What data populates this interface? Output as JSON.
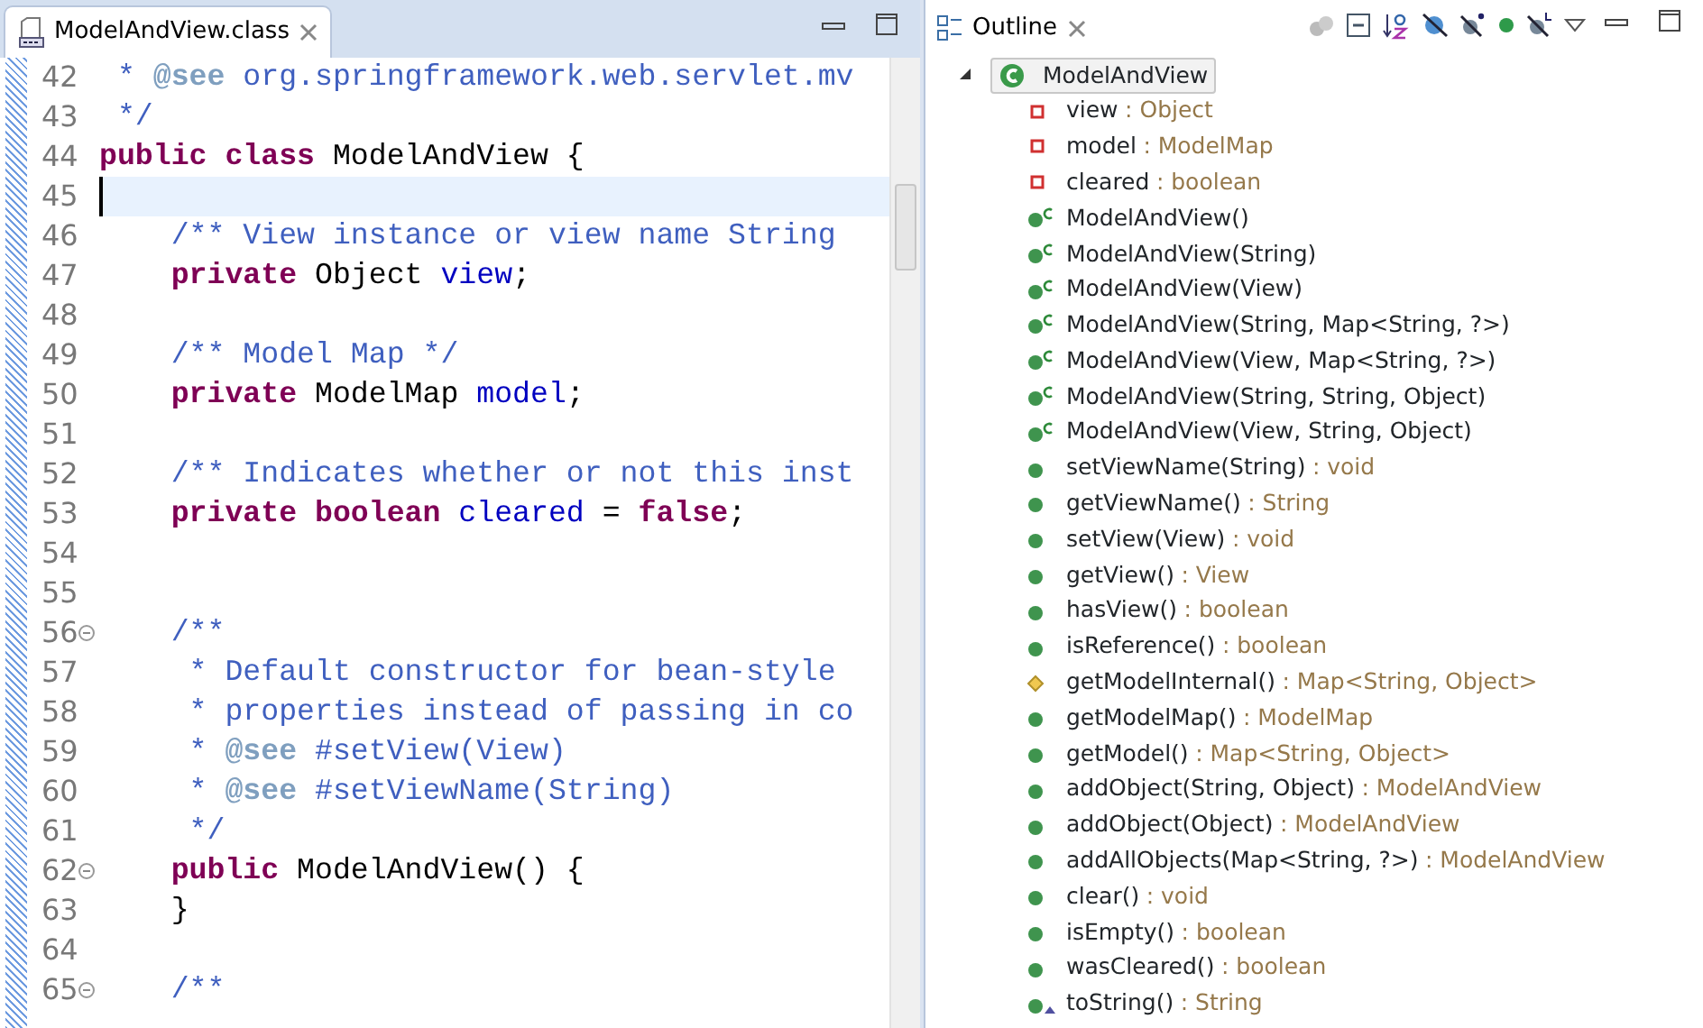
{
  "editor": {
    "tab": {
      "title": "ModelAndView.class",
      "selected": true
    },
    "lines": [
      {
        "number": "42",
        "fold": false,
        "current": false,
        "tokens": [
          {
            "kind": "comment",
            "text": " * "
          },
          {
            "kind": "doctag",
            "text": "@see"
          },
          {
            "kind": "comment",
            "text": " org.springframework.web.servlet.mv"
          }
        ]
      },
      {
        "number": "43",
        "fold": false,
        "current": false,
        "tokens": [
          {
            "kind": "comment",
            "text": " */"
          }
        ]
      },
      {
        "number": "44",
        "fold": false,
        "current": false,
        "tokens": [
          {
            "kind": "keyword",
            "text": "public class"
          },
          {
            "kind": "plain",
            "text": " ModelAndView {"
          }
        ]
      },
      {
        "number": "45",
        "fold": false,
        "current": true
      },
      {
        "number": "46",
        "fold": false,
        "current": false,
        "tokens": [
          {
            "kind": "comment",
            "text": "    /** View instance or view name String"
          }
        ]
      },
      {
        "number": "47",
        "fold": false,
        "current": false,
        "tokens": [
          {
            "kind": "keyword",
            "text": "    private"
          },
          {
            "kind": "plain",
            "text": " Object "
          },
          {
            "kind": "field",
            "text": "view"
          },
          {
            "kind": "plain",
            "text": ";"
          }
        ]
      },
      {
        "number": "48",
        "fold": false,
        "current": false
      },
      {
        "number": "49",
        "fold": false,
        "current": false,
        "tokens": [
          {
            "kind": "comment",
            "text": "    /** Model Map */"
          }
        ]
      },
      {
        "number": "50",
        "fold": false,
        "current": false,
        "tokens": [
          {
            "kind": "keyword",
            "text": "    private"
          },
          {
            "kind": "plain",
            "text": " ModelMap "
          },
          {
            "kind": "field",
            "text": "model"
          },
          {
            "kind": "plain",
            "text": ";"
          }
        ]
      },
      {
        "number": "51",
        "fold": false,
        "current": false
      },
      {
        "number": "52",
        "fold": false,
        "current": false,
        "tokens": [
          {
            "kind": "comment",
            "text": "    /** Indicates whether or not this inst"
          }
        ]
      },
      {
        "number": "53",
        "fold": false,
        "current": false,
        "tokens": [
          {
            "kind": "keyword",
            "text": "    private boolean "
          },
          {
            "kind": "field",
            "text": "cleared"
          },
          {
            "kind": "plain",
            "text": " = "
          },
          {
            "kind": "keyword",
            "text": "false"
          },
          {
            "kind": "plain",
            "text": ";"
          }
        ]
      },
      {
        "number": "54",
        "fold": false,
        "current": false
      },
      {
        "number": "55",
        "fold": false,
        "current": false
      },
      {
        "number": "56",
        "fold": true,
        "current": false,
        "tokens": [
          {
            "kind": "comment",
            "text": "    /**"
          }
        ]
      },
      {
        "number": "57",
        "fold": false,
        "current": false,
        "tokens": [
          {
            "kind": "comment",
            "text": "     * Default constructor for bean-style"
          }
        ]
      },
      {
        "number": "58",
        "fold": false,
        "current": false,
        "tokens": [
          {
            "kind": "comment",
            "text": "     * properties instead of passing in co"
          }
        ]
      },
      {
        "number": "59",
        "fold": false,
        "current": false,
        "tokens": [
          {
            "kind": "comment",
            "text": "     * "
          },
          {
            "kind": "doctag",
            "text": "@see"
          },
          {
            "kind": "comment",
            "text": " #setView(View)"
          }
        ]
      },
      {
        "number": "60",
        "fold": false,
        "current": false,
        "tokens": [
          {
            "kind": "comment",
            "text": "     * "
          },
          {
            "kind": "doctag",
            "text": "@see"
          },
          {
            "kind": "comment",
            "text": " #setViewName(String)"
          }
        ]
      },
      {
        "number": "61",
        "fold": false,
        "current": false,
        "tokens": [
          {
            "kind": "comment",
            "text": "     */"
          }
        ]
      },
      {
        "number": "62",
        "fold": true,
        "current": false,
        "tokens": [
          {
            "kind": "keyword",
            "text": "    public"
          },
          {
            "kind": "plain",
            "text": " ModelAndView() {"
          }
        ]
      },
      {
        "number": "63",
        "fold": false,
        "current": false,
        "tokens": [
          {
            "kind": "plain",
            "text": "    }"
          }
        ]
      },
      {
        "number": "64",
        "fold": false,
        "current": false
      },
      {
        "number": "65",
        "fold": true,
        "current": false,
        "tokens": [
          {
            "kind": "comment",
            "text": "    /**"
          }
        ]
      }
    ]
  },
  "outline": {
    "tab": {
      "title": "Outline",
      "selected": true
    },
    "root": {
      "name": "ModelAndView",
      "expanded": true,
      "selected": true,
      "children": [
        {
          "kind": "field",
          "name": "view",
          "type": ": Object"
        },
        {
          "kind": "field",
          "name": "model",
          "type": ": ModelMap"
        },
        {
          "kind": "field",
          "name": "cleared",
          "type": ": boolean"
        },
        {
          "kind": "constructor",
          "name": "ModelAndView()"
        },
        {
          "kind": "constructor",
          "name": "ModelAndView(String)"
        },
        {
          "kind": "constructor",
          "name": "ModelAndView(View)"
        },
        {
          "kind": "constructor",
          "name": "ModelAndView(String, Map<String, ?>)"
        },
        {
          "kind": "constructor",
          "name": "ModelAndView(View, Map<String, ?>)"
        },
        {
          "kind": "constructor",
          "name": "ModelAndView(String, String, Object)"
        },
        {
          "kind": "constructor",
          "name": "ModelAndView(View, String, Object)"
        },
        {
          "kind": "method",
          "name": "setViewName(String)",
          "type": ": void"
        },
        {
          "kind": "method",
          "name": "getViewName()",
          "type": ": String"
        },
        {
          "kind": "method",
          "name": "setView(View)",
          "type": ": void"
        },
        {
          "kind": "method",
          "name": "getView()",
          "type": ": View"
        },
        {
          "kind": "method",
          "name": "hasView()",
          "type": ": boolean"
        },
        {
          "kind": "method",
          "name": "isReference()",
          "type": ": boolean"
        },
        {
          "kind": "protected",
          "name": "getModelInternal()",
          "type": ": Map<String, Object>"
        },
        {
          "kind": "method",
          "name": "getModelMap()",
          "type": ": ModelMap"
        },
        {
          "kind": "method",
          "name": "getModel()",
          "type": ": Map<String, Object>"
        },
        {
          "kind": "method",
          "name": "addObject(String, Object)",
          "type": ": ModelAndView"
        },
        {
          "kind": "method",
          "name": "addObject(Object)",
          "type": ": ModelAndView"
        },
        {
          "kind": "method",
          "name": "addAllObjects(Map<String, ?>)",
          "type": ": ModelAndView"
        },
        {
          "kind": "method",
          "name": "clear()",
          "type": ": void"
        },
        {
          "kind": "method",
          "name": "isEmpty()",
          "type": ": boolean"
        },
        {
          "kind": "method",
          "name": "wasCleared()",
          "type": ": boolean"
        },
        {
          "kind": "override",
          "name": "toString()",
          "type": ": String"
        }
      ]
    }
  }
}
